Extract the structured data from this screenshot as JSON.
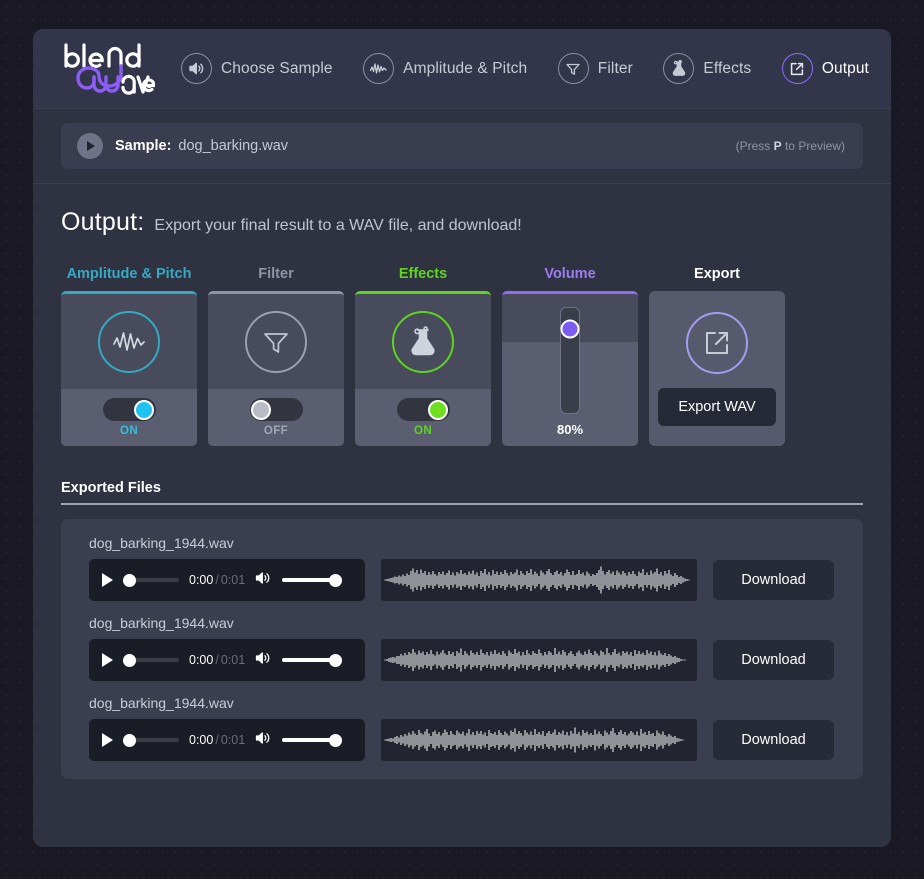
{
  "app": {
    "logo": {
      "line1": "blend",
      "line2": "ave",
      "accent_color": "#8b5cf6"
    }
  },
  "nav": {
    "items": [
      {
        "label": "Choose Sample",
        "icon": "speaker-icon",
        "active": false
      },
      {
        "label": "Amplitude & Pitch",
        "icon": "waveform-icon",
        "active": false
      },
      {
        "label": "Filter",
        "icon": "funnel-icon",
        "active": false
      },
      {
        "label": "Effects",
        "icon": "flask-icon",
        "active": false
      },
      {
        "label": "Output",
        "icon": "export-icon",
        "active": true
      }
    ]
  },
  "sample_bar": {
    "play_icon": "play-icon",
    "label": "Sample:",
    "filename": "dog_barking.wav",
    "hint_prefix": "(Press ",
    "hint_key": "P",
    "hint_suffix": " to Preview)"
  },
  "page": {
    "title": "Output:",
    "subtitle": "Export your final result to a WAV file, and download!"
  },
  "modules": [
    {
      "title": "Amplitude & Pitch",
      "icon": "waveform-icon",
      "accent": "#35a9c4",
      "state_label": "ON",
      "state_on": true
    },
    {
      "title": "Filter",
      "icon": "funnel-icon",
      "accent": "#9aa0b2",
      "state_label": "OFF",
      "state_on": false
    },
    {
      "title": "Effects",
      "icon": "flask-icon",
      "accent": "#5ed41f",
      "state_label": "ON",
      "state_on": true
    }
  ],
  "volume": {
    "title": "Volume",
    "accent": "#8b6ff0",
    "value_label": "80%",
    "value": 80
  },
  "export": {
    "title": "Export",
    "icon": "export-icon",
    "accent": "#a79bf0",
    "button_label": "Export WAV"
  },
  "exported_files": {
    "heading": "Exported Files",
    "rows": [
      {
        "filename": "dog_barking_1944.wav",
        "current_time": "0:00",
        "separator": "/",
        "duration": "0:01",
        "play_icon": "play-icon",
        "volume_icon": "speaker-icon",
        "download_label": "Download"
      },
      {
        "filename": "dog_barking_1944.wav",
        "current_time": "0:00",
        "separator": "/",
        "duration": "0:01",
        "play_icon": "play-icon",
        "volume_icon": "speaker-icon",
        "download_label": "Download"
      },
      {
        "filename": "dog_barking_1944.wav",
        "current_time": "0:00",
        "separator": "/",
        "duration": "0:01",
        "play_icon": "play-icon",
        "volume_icon": "speaker-icon",
        "download_label": "Download"
      }
    ]
  }
}
